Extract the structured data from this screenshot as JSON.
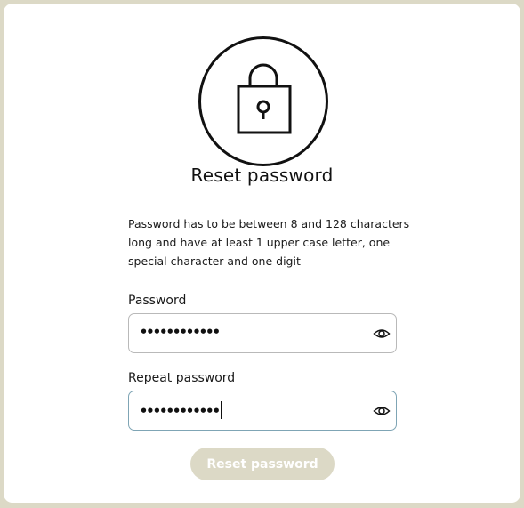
{
  "icons": {
    "header": "lock-icon",
    "show_password": "eye-icon"
  },
  "colors": {
    "page_background": "#dcd9c6",
    "card_background": "#ffffff",
    "button_background": "#dcd9c6",
    "button_text": "#ffffff",
    "focused_border": "#7fa5b5"
  },
  "heading": "Reset password",
  "hint": "Password has to be between 8 and 128 characters long and have at least 1 upper case letter, one special character and one digit",
  "fields": {
    "password": {
      "label": "Password",
      "masked_value": "••••••••••••"
    },
    "repeat_password": {
      "label": "Repeat password",
      "masked_value": "••••••••••••"
    }
  },
  "submit_label": "Reset password"
}
